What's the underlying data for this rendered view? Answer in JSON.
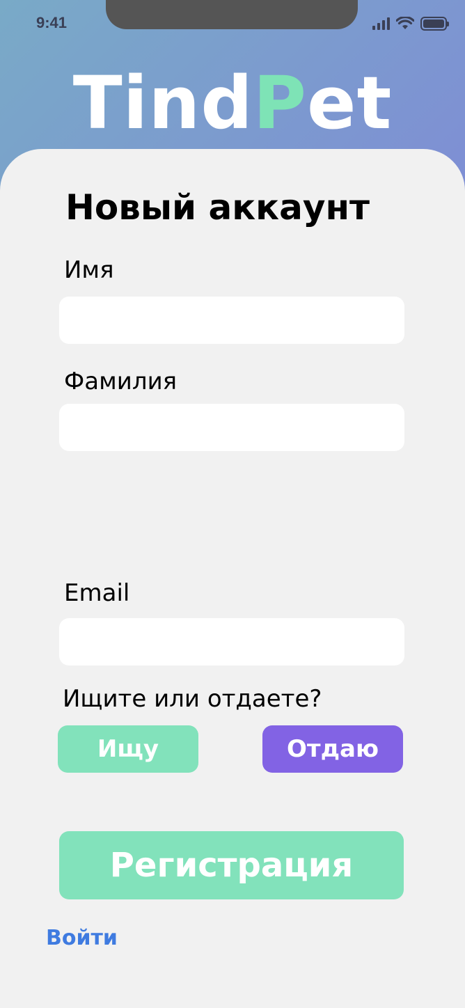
{
  "status_bar": {
    "time": "9:41",
    "icons": [
      "cellular-signal-icon",
      "wifi-icon",
      "battery-icon"
    ]
  },
  "logo": {
    "part1": "Tind",
    "part2": "P",
    "part3": "et"
  },
  "form": {
    "title": "Новый аккаунт",
    "fields": [
      {
        "label": "Имя",
        "value": "",
        "placeholder": ""
      },
      {
        "label": "Фамилия",
        "value": "",
        "placeholder": ""
      },
      {
        "label": "Email",
        "value": "",
        "placeholder": ""
      }
    ],
    "question": "Ищите или отдаете?",
    "choices": {
      "seek": "Ищу",
      "give": "Отдаю"
    },
    "register_label": "Регистрация",
    "login_label": "Войти"
  },
  "colors": {
    "accent_green": "#82e2bb",
    "accent_purple": "#8263e4",
    "link_blue": "#3f7be0",
    "card_bg": "#f1f1f1"
  }
}
